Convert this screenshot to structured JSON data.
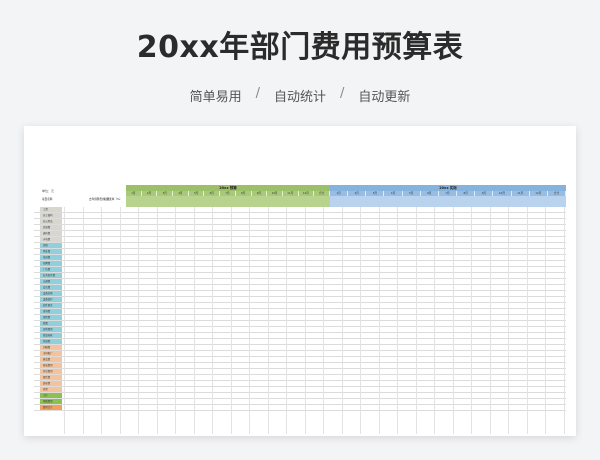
{
  "header": {
    "title": "20xx年部门费用预算表",
    "features": [
      "简单易用",
      "自动统计",
      "自动更新"
    ],
    "separator": "/"
  },
  "sheet": {
    "unit": "单位：元",
    "budget_group": "20xx 预算",
    "actual_group": "20xx 实际",
    "months": [
      "1月",
      "2月",
      "3月",
      "4月",
      "5月",
      "6月",
      "7月",
      "8月",
      "9月",
      "10月",
      "11月",
      "12月"
    ],
    "total_label": "合计",
    "col_category": "项目名称",
    "col_prev": "去年预算费用（元）",
    "col_ratio": "较增长率（%）",
    "colors": {
      "budget_header": "#9dbf6a",
      "actual_header": "#86b3de",
      "cat_green": "#c5d8a6",
      "cat_blue": "#8fd0dc",
      "cat_orange": "#f4c39b",
      "cat_grey": "#d7d7cf",
      "total_orange": "#f3a15a",
      "sum_green": "#8dc14f"
    },
    "rows": [
      {
        "label": "工资",
        "cat": "grey"
      },
      {
        "label": "员工福利",
        "cat": "grey"
      },
      {
        "label": "办公用品",
        "cat": "grey"
      },
      {
        "label": "差旅费",
        "cat": "grey"
      },
      {
        "label": "通讯费",
        "cat": "grey"
      },
      {
        "label": "水电费",
        "cat": "grey"
      },
      {
        "label": "房租",
        "cat": "blue"
      },
      {
        "label": "物业费",
        "cat": "blue"
      },
      {
        "label": "培训费",
        "cat": "blue"
      },
      {
        "label": "招聘费",
        "cat": "blue"
      },
      {
        "label": "广告费",
        "cat": "blue"
      },
      {
        "label": "业务招待费",
        "cat": "blue"
      },
      {
        "label": "交通费",
        "cat": "blue"
      },
      {
        "label": "会议费",
        "cat": "blue"
      },
      {
        "label": "设备采购",
        "cat": "blue"
      },
      {
        "label": "设备维护",
        "cat": "blue"
      },
      {
        "label": "软件服务",
        "cat": "blue"
      },
      {
        "label": "咨询费",
        "cat": "blue"
      },
      {
        "label": "保险费",
        "cat": "blue"
      },
      {
        "label": "税费",
        "cat": "blue"
      },
      {
        "label": "其他费用",
        "cat": "blue"
      },
      {
        "label": "低值易耗",
        "cat": "blue"
      },
      {
        "label": "快递费",
        "cat": "blue"
      },
      {
        "label": "印刷费",
        "cat": "orange"
      },
      {
        "label": "市场推广",
        "cat": "orange"
      },
      {
        "label": "展会费",
        "cat": "orange"
      },
      {
        "label": "研发费用",
        "cat": "orange"
      },
      {
        "label": "外包费用",
        "cat": "orange"
      },
      {
        "label": "租赁费",
        "cat": "orange"
      },
      {
        "label": "装修费",
        "cat": "orange"
      },
      {
        "label": "其他",
        "cat": "orange"
      },
      {
        "label": "小计",
        "cat": "green"
      },
      {
        "label": "预留费用",
        "cat": "green"
      },
      {
        "label": "费用合计",
        "cat": "total"
      }
    ]
  }
}
